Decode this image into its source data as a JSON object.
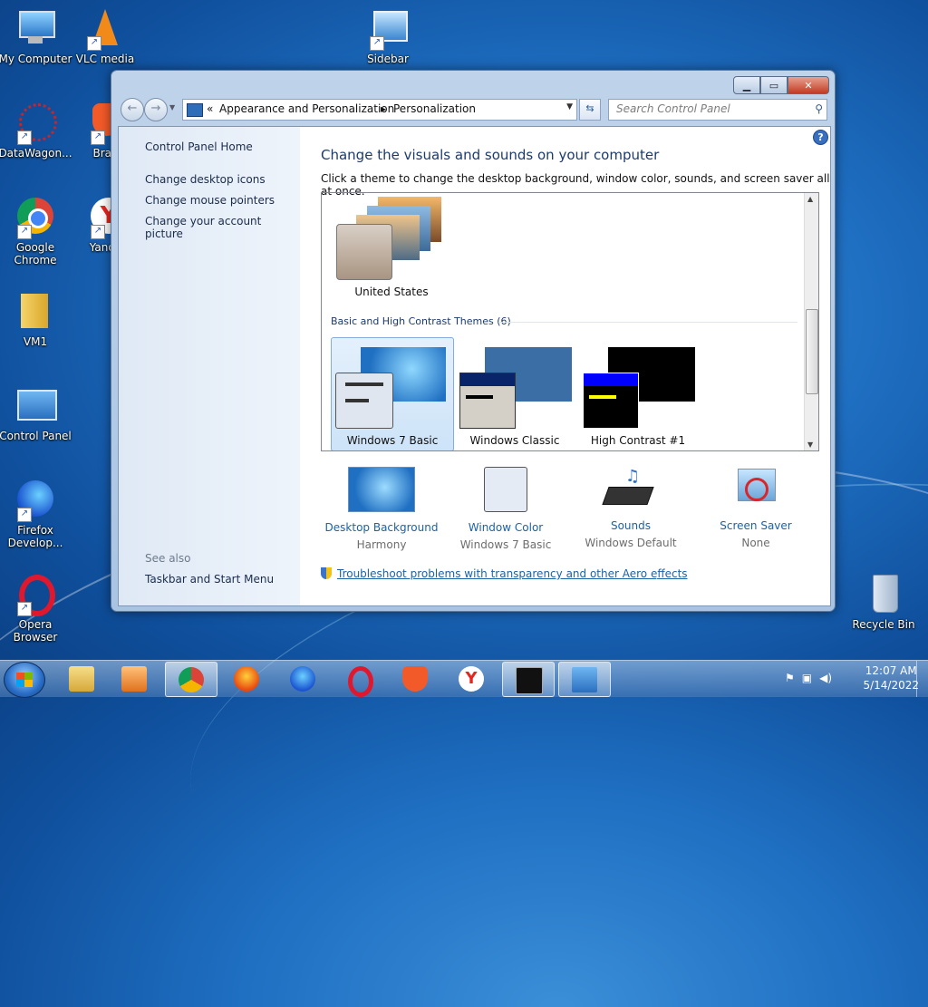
{
  "desktop": {
    "icons": [
      {
        "label": "My Computer"
      },
      {
        "label": "VLC media player"
      },
      {
        "label": "Sidebar"
      },
      {
        "label": "DataWagon..."
      },
      {
        "label": "Brave"
      },
      {
        "label": "Google Chrome"
      },
      {
        "label": "Yandex"
      },
      {
        "label": "VM1"
      },
      {
        "label": "Control Panel"
      },
      {
        "label": "Firefox Develop..."
      },
      {
        "label": "Opera Browser"
      },
      {
        "label": "Recycle Bin"
      }
    ]
  },
  "window": {
    "address": {
      "prefix": "«",
      "crumb1": "Appearance and Personalization",
      "crumb2": "Personalization"
    },
    "search_placeholder": "Search Control Panel",
    "left": {
      "home": "Control Panel Home",
      "links": [
        "Change desktop icons",
        "Change mouse pointers",
        "Change your account picture"
      ],
      "see_also": "See also",
      "taskbar": "Taskbar and Start Menu"
    },
    "main": {
      "title": "Change the visuals and sounds on your computer",
      "subtitle": "Click a theme to change the desktop background, window color, sounds, and screen saver all at once.",
      "my_theme": "United States",
      "group_label": "Basic and High Contrast Themes (6)",
      "themes": [
        "Windows 7 Basic",
        "Windows Classic",
        "High Contrast #1"
      ],
      "options": [
        {
          "label": "Desktop Background",
          "value": "Harmony"
        },
        {
          "label": "Window Color",
          "value": "Windows 7 Basic"
        },
        {
          "label": "Sounds",
          "value": "Windows Default"
        },
        {
          "label": "Screen Saver",
          "value": "None"
        }
      ],
      "troubleshoot": "Troubleshoot problems with transparency and other Aero effects"
    }
  },
  "taskbar": {
    "time": "12:07 AM",
    "date": "5/14/2022"
  },
  "colors": {
    "link": "#1c62a6",
    "heading": "#1c3a6e"
  }
}
